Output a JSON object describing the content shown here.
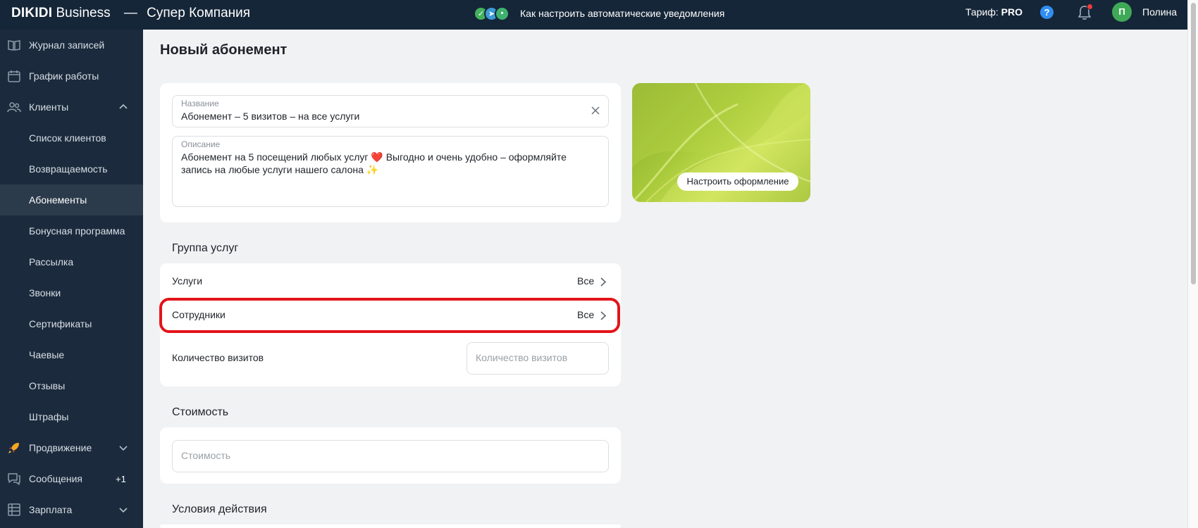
{
  "header": {
    "brand": "DIKIDI",
    "brand_suffix": "Business",
    "separator": "—",
    "company": "Супер Компания",
    "promo_text": "Как настроить автоматические уведомления",
    "tariff_label": "Тариф:",
    "tariff_value": "PRO",
    "help_label": "?",
    "avatar_letter": "П",
    "user_name": "Полина"
  },
  "sidebar": {
    "items": [
      {
        "label": "Журнал записей"
      },
      {
        "label": "График работы"
      },
      {
        "label": "Клиенты"
      },
      {
        "label": "Список клиентов"
      },
      {
        "label": "Возвращаемость"
      },
      {
        "label": "Абонементы"
      },
      {
        "label": "Бонусная программа"
      },
      {
        "label": "Рассылка"
      },
      {
        "label": "Звонки"
      },
      {
        "label": "Сертификаты"
      },
      {
        "label": "Чаевые"
      },
      {
        "label": "Отзывы"
      },
      {
        "label": "Штрафы"
      },
      {
        "label": "Продвижение"
      },
      {
        "label": "Сообщения",
        "badge": "+1"
      },
      {
        "label": "Зарплата"
      }
    ]
  },
  "form": {
    "page_title": "Новый абонемент",
    "name_label": "Название",
    "name_value": "Абонемент – 5 визитов – на все услуги",
    "description_label": "Описание",
    "description_line1": "Абонемент на 5 посещений любых услуг ❤️ Выгодно и очень удобно – оформляйте",
    "description_line2": "запись на любые услуги нашего салона ✨",
    "design_button": "Настроить оформление",
    "group_title": "Группа услуг",
    "services_label": "Услуги",
    "services_value": "Все",
    "staff_label": "Сотрудники",
    "staff_value": "Все",
    "visits_label": "Количество визитов",
    "visits_placeholder": "Количество визитов",
    "cost_title": "Стоимость",
    "cost_placeholder": "Стоимость",
    "conditions_title": "Условия действия"
  },
  "colors": {
    "topbar": "#152638",
    "sidebar": "#1b2b3d",
    "highlight": "#e3141a",
    "avatar": "#3fa958"
  }
}
